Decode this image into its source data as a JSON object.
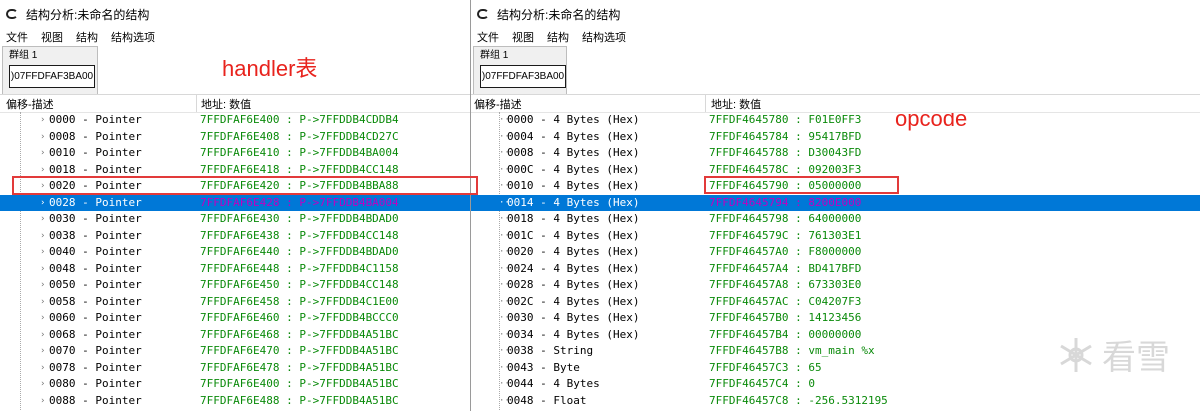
{
  "left_window": {
    "title": "结构分析:未命名的结构",
    "menu": [
      "文件",
      "视图",
      "结构",
      "结构选项"
    ],
    "group_label": "群组 1",
    "address": ")07FFDFAF3BA00",
    "col_offset_header": "偏移-描述",
    "col_value_header": "地址: 数值",
    "annotation": "handler表",
    "rows": [
      {
        "offset": "0000 - Pointer",
        "value": "7FFDFAF6E400 : P->7FFDDB4CDDB4"
      },
      {
        "offset": "0008 - Pointer",
        "value": "7FFDFAF6E408 : P->7FFDDB4CD27C"
      },
      {
        "offset": "0010 - Pointer",
        "value": "7FFDFAF6E410 : P->7FFDDB4BA004"
      },
      {
        "offset": "0018 - Pointer",
        "value": "7FFDFAF6E418 : P->7FFDDB4CC148"
      },
      {
        "offset": "0020 - Pointer",
        "value": "7FFDFAF6E420 : P->7FFDDB4BBA88"
      },
      {
        "offset": "0028 - Pointer",
        "value": "7FFDFAF6E428 : P->7FFDDB4BA004"
      },
      {
        "offset": "0030 - Pointer",
        "value": "7FFDFAF6E430 : P->7FFDDB4BDAD0"
      },
      {
        "offset": "0038 - Pointer",
        "value": "7FFDFAF6E438 : P->7FFDDB4CC148"
      },
      {
        "offset": "0040 - Pointer",
        "value": "7FFDFAF6E440 : P->7FFDDB4BDAD0"
      },
      {
        "offset": "0048 - Pointer",
        "value": "7FFDFAF6E448 : P->7FFDDB4C1158"
      },
      {
        "offset": "0050 - Pointer",
        "value": "7FFDFAF6E450 : P->7FFDDB4CC148"
      },
      {
        "offset": "0058 - Pointer",
        "value": "7FFDFAF6E458 : P->7FFDDB4C1E00"
      },
      {
        "offset": "0060 - Pointer",
        "value": "7FFDFAF6E460 : P->7FFDDB4BCCC0"
      },
      {
        "offset": "0068 - Pointer",
        "value": "7FFDFAF6E468 : P->7FFDDB4A51BC"
      },
      {
        "offset": "0070 - Pointer",
        "value": "7FFDFAF6E470 : P->7FFDDB4A51BC"
      },
      {
        "offset": "0078 - Pointer",
        "value": "7FFDFAF6E478 : P->7FFDDB4A51BC"
      },
      {
        "offset": "0080 - Pointer",
        "value": "7FFDFAF6E400 : P->7FFDDB4A51BC"
      },
      {
        "offset": "0088 - Pointer",
        "value": "7FFDFAF6E488 : P->7FFDDB4A51BC"
      }
    ]
  },
  "right_window": {
    "title": "结构分析:未命名的结构",
    "menu": [
      "文件",
      "视图",
      "结构",
      "结构选项"
    ],
    "group_label": "群组 1",
    "address": ")07FFDFAF3BA00",
    "col_offset_header": "偏移-描述",
    "col_value_header": "地址: 数值",
    "annotation": "opcode",
    "rows": [
      {
        "offset": "0000 - 4 Bytes (Hex)",
        "value": "7FFDF4645780 : F01E0FF3"
      },
      {
        "offset": "0004 - 4 Bytes (Hex)",
        "value": "7FFDF4645784 : 95417BFD"
      },
      {
        "offset": "0008 - 4 Bytes (Hex)",
        "value": "7FFDF4645788 : D30043FD"
      },
      {
        "offset": "000C - 4 Bytes (Hex)",
        "value": "7FFDF464578C : 092003F3"
      },
      {
        "offset": "0010 - 4 Bytes (Hex)",
        "value": "7FFDF4645790 : 05000000"
      },
      {
        "offset": "0014 - 4 Bytes (Hex)",
        "value": "7FFDF4645794 : 8200E000"
      },
      {
        "offset": "0018 - 4 Bytes (Hex)",
        "value": "7FFDF4645798 : 64000000"
      },
      {
        "offset": "001C - 4 Bytes (Hex)",
        "value": "7FFDF464579C : 761303E1"
      },
      {
        "offset": "0020 - 4 Bytes (Hex)",
        "value": "7FFDF46457A0 : F8000000"
      },
      {
        "offset": "0024 - 4 Bytes (Hex)",
        "value": "7FFDF46457A4 : BD417BFD"
      },
      {
        "offset": "0028 - 4 Bytes (Hex)",
        "value": "7FFDF46457A8 : 673303E0"
      },
      {
        "offset": "002C - 4 Bytes (Hex)",
        "value": "7FFDF46457AC : C04207F3"
      },
      {
        "offset": "0030 - 4 Bytes (Hex)",
        "value": "7FFDF46457B0 : 14123456"
      },
      {
        "offset": "0034 - 4 Bytes (Hex)",
        "value": "7FFDF46457B4 : 00000000"
      },
      {
        "offset": "0038 - String",
        "value": "7FFDF46457B8 : vm_main %x"
      },
      {
        "offset": "0043 - Byte",
        "value": "7FFDF46457C3 : 65"
      },
      {
        "offset": "0044 - 4 Bytes",
        "value": "7FFDF46457C4 : 0"
      },
      {
        "offset": "0048 - Float",
        "value": "7FFDF46457C8 : -256.5312195"
      }
    ]
  },
  "watermark": "看雪",
  "colors": {
    "selection": "#0078d7",
    "value_text": "#0a8a0a",
    "annotation": "#e8231d",
    "highlight_box": "#e23a3a"
  }
}
